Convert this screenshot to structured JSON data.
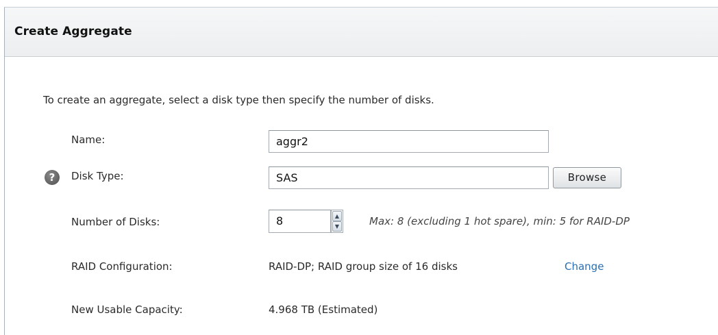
{
  "dialog": {
    "title": "Create Aggregate",
    "intro": "To create an aggregate, select a disk type then specify the number of disks."
  },
  "form": {
    "name_label": "Name:",
    "name_value": "aggr2",
    "disk_type_label": "Disk Type:",
    "disk_type_value": "SAS",
    "browse_label": "Browse",
    "help_icon_glyph": "?",
    "num_disks_label": "Number of Disks:",
    "num_disks_value": "8",
    "num_disks_hint": "Max: 8 (excluding 1 hot spare), min: 5 for RAID-DP",
    "raid_label": "RAID Configuration:",
    "raid_value": "RAID-DP; RAID group size of 16 disks",
    "raid_change_link": "Change",
    "capacity_label": "New Usable Capacity:",
    "capacity_value": "4.968 TB (Estimated)"
  },
  "icons": {
    "help": "help-icon",
    "spin_up": "arrow-up-icon",
    "spin_down": "arrow-down-icon"
  },
  "colors": {
    "link": "#2a6fb3",
    "title_bar": "#eceef0",
    "border": "#a3aab1"
  }
}
